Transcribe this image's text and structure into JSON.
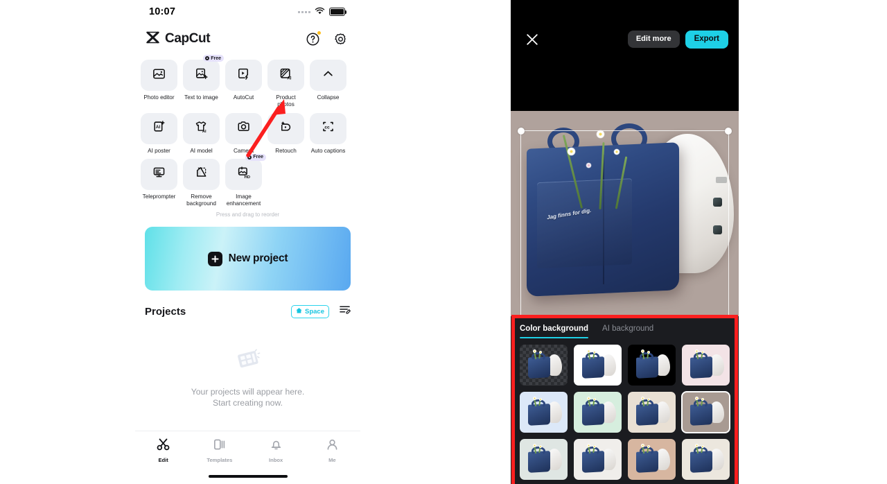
{
  "left_phone": {
    "status_bar": {
      "time": "10:07",
      "signal_icon": "signal-dots-icon",
      "wifi_icon": "wifi-icon",
      "battery_icon": "battery-full-icon"
    },
    "app_bar": {
      "brand_name": "CapCut",
      "logo_icon": "capcut-logo-icon",
      "help_icon": "help-circle-icon",
      "settings_icon": "gear-icon"
    },
    "tools": {
      "rows": [
        [
          {
            "label": "Photo editor",
            "icon": "photo-editor-icon",
            "badge": null
          },
          {
            "label": "Text to image",
            "icon": "text-to-image-icon",
            "badge": "Free"
          },
          {
            "label": "AutoCut",
            "icon": "autocut-icon",
            "badge": null
          },
          {
            "label": "Product photos",
            "icon": "product-photos-ai-icon",
            "badge": null
          },
          {
            "label": "Collapse",
            "icon": "chevron-up-icon",
            "badge": null
          }
        ],
        [
          {
            "label": "AI poster",
            "icon": "ai-poster-icon",
            "badge": null
          },
          {
            "label": "AI model",
            "icon": "ai-model-icon",
            "badge": null
          },
          {
            "label": "Camera",
            "icon": "camera-icon",
            "badge": null
          },
          {
            "label": "Retouch",
            "icon": "retouch-icon",
            "badge": null
          },
          {
            "label": "Auto captions",
            "icon": "auto-captions-icon",
            "badge": null
          }
        ],
        [
          {
            "label": "Teleprompter",
            "icon": "teleprompter-icon",
            "badge": null
          },
          {
            "label": "Remove\nbackground",
            "icon": "remove-background-icon",
            "badge": null
          },
          {
            "label": "Image\nenhancement",
            "icon": "image-enhancement-hd-icon",
            "badge": "Free"
          }
        ]
      ],
      "reorder_hint": "Press and drag to reorder"
    },
    "new_project": {
      "label": "New project",
      "icon": "plus-square-icon"
    },
    "projects": {
      "title": "Projects",
      "space_badge": "Space",
      "space_icon": "cloud-space-icon",
      "sort_icon": "sort-edit-icon"
    },
    "empty_state": {
      "icon": "film-strip-icon",
      "line1": "Your projects will appear here.",
      "line2": "Start creating now."
    },
    "bottom_nav": [
      {
        "label": "Edit",
        "icon": "scissors-icon",
        "active": true
      },
      {
        "label": "Templates",
        "icon": "templates-icon",
        "active": false
      },
      {
        "label": "Inbox",
        "icon": "bell-icon",
        "active": false
      },
      {
        "label": "Me",
        "icon": "person-icon",
        "active": false
      }
    ]
  },
  "right_phone": {
    "top_bar": {
      "close_icon": "close-x-icon",
      "edit_more_label": "Edit more",
      "export_label": "Export"
    },
    "preview": {
      "embroidery_text": "Jag finns for dig.",
      "crop_handle_icon": "crop-handle-icon",
      "background_color": "#b0a29c"
    },
    "sheet": {
      "tabs": [
        {
          "label": "Color background",
          "active": true
        },
        {
          "label": "AI background",
          "active": false
        }
      ],
      "accent_color": "#1ed0e6",
      "thumbnails": [
        {
          "name": "transparent",
          "color": "transparent",
          "selected": false
        },
        {
          "name": "white",
          "color": "#ffffff",
          "selected": false
        },
        {
          "name": "black",
          "color": "#000000",
          "selected": false
        },
        {
          "name": "pink",
          "color": "#f3e3e6",
          "selected": false
        },
        {
          "name": "light-blue",
          "color": "#dce8f8",
          "selected": false
        },
        {
          "name": "mint-green",
          "color": "#d6eede",
          "selected": false
        },
        {
          "name": "beige",
          "color": "#e9e0d4",
          "selected": false
        },
        {
          "name": "taupe",
          "color": "#a89a92",
          "selected": true
        },
        {
          "name": "pale-gray-green",
          "color": "#dfe6e3",
          "selected": false
        },
        {
          "name": "off-white",
          "color": "#f0eeeb",
          "selected": false
        },
        {
          "name": "tan",
          "color": "#d7b6a0",
          "selected": false
        },
        {
          "name": "cream",
          "color": "#ece7de",
          "selected": false
        }
      ]
    }
  },
  "annotations": {
    "arrow_color": "#fb1f1f",
    "arrow_target": "Product photos",
    "box_color": "#fb1f1f",
    "box_target": "Color background panel"
  }
}
